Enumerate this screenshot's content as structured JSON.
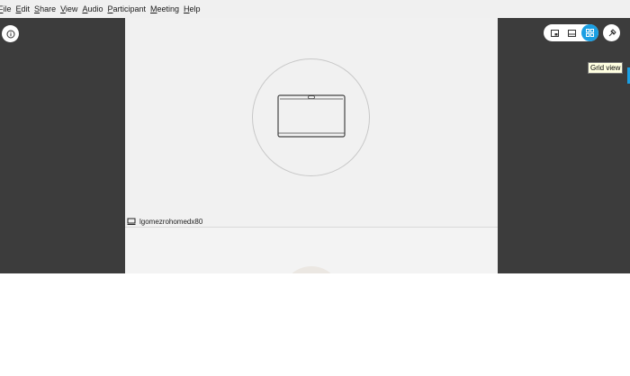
{
  "menubar": {
    "items": [
      {
        "label": "File",
        "mnemonic": "F"
      },
      {
        "label": "Edit",
        "mnemonic": "E"
      },
      {
        "label": "Share",
        "mnemonic": "S"
      },
      {
        "label": "View",
        "mnemonic": "V"
      },
      {
        "label": "Audio",
        "mnemonic": "A"
      },
      {
        "label": "Participant",
        "mnemonic": "P"
      },
      {
        "label": "Meeting",
        "mnemonic": "M"
      },
      {
        "label": "Help",
        "mnemonic": "H"
      }
    ]
  },
  "participant": {
    "name": "lgomezrohomedx80",
    "tag_icon": "device-icon",
    "placeholder_icon": "video-device-icon"
  },
  "controls": {
    "info_icon": "info-icon",
    "views": [
      {
        "name": "floating-panel-view",
        "icon": "pip-icon",
        "active": false
      },
      {
        "name": "stage-view",
        "icon": "stage-icon",
        "active": false
      },
      {
        "name": "grid-view",
        "icon": "grid-icon",
        "active": true
      }
    ],
    "pin_icon": "pin-icon",
    "tooltip": "Grid view"
  },
  "colors": {
    "accent": "#1a9fe3",
    "stage_bg": "#3c3c3c",
    "tile_bg": "#f1f1f1",
    "tooltip_bg": "#ffffe1"
  }
}
